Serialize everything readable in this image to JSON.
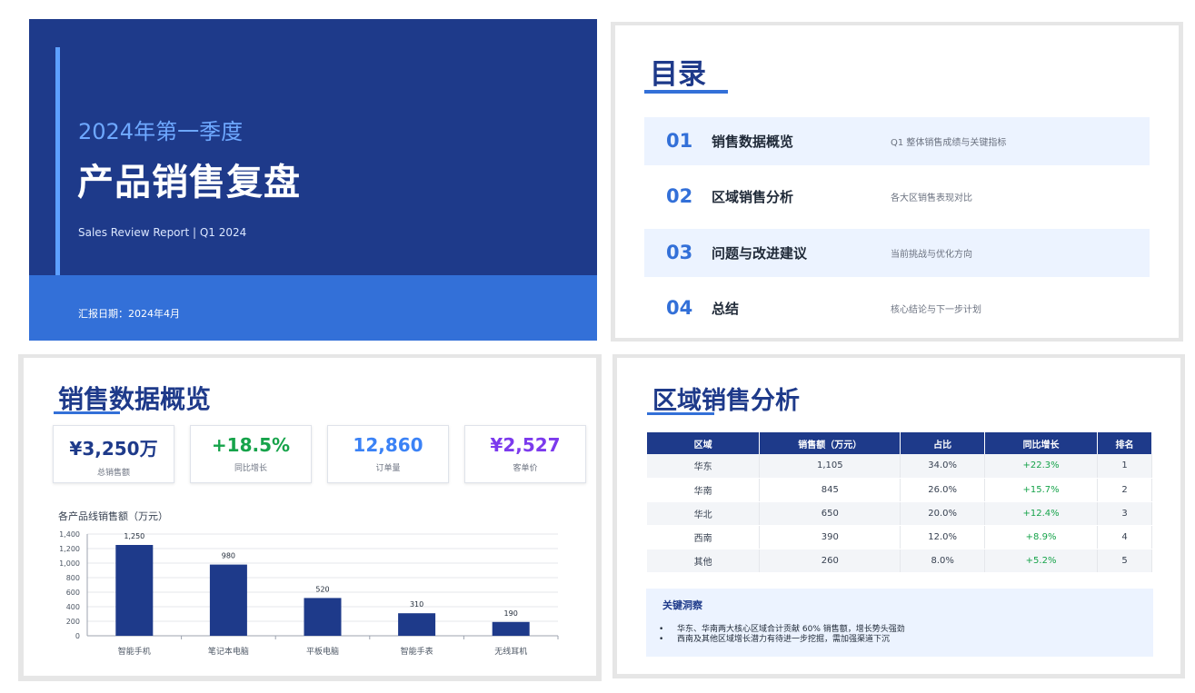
{
  "cover": {
    "subtitle": "2024年第一季度",
    "title": "产品销售复盘",
    "subtitle_en": "Sales Review Report | Q1 2024",
    "date_line": "汇报日期：2024年4月"
  },
  "agenda": {
    "title": "目录",
    "items": [
      {
        "num": "01",
        "name": "销售数据概览",
        "desc": "Q1 整体销售成绩与关键指标"
      },
      {
        "num": "02",
        "name": "区域销售分析",
        "desc": "各大区销售表现对比"
      },
      {
        "num": "03",
        "name": "问题与改进建议",
        "desc": "当前挑战与优化方向"
      },
      {
        "num": "04",
        "name": "总结",
        "desc": "核心结论与下一步计划"
      }
    ]
  },
  "overview": {
    "title": "销售数据概览",
    "kpis": [
      {
        "value": "¥3,250万",
        "label": "总销售额",
        "color": "#1e3a8a"
      },
      {
        "value": "+18.5%",
        "label": "同比增长",
        "color": "#16a34a"
      },
      {
        "value": "12,860",
        "label": "订单量",
        "color": "#3b82f6"
      },
      {
        "value": "¥2,527",
        "label": "客单价",
        "color": "#7c3aed"
      }
    ],
    "chart_title": "各产品线销售额（万元）"
  },
  "chart_data": {
    "type": "bar",
    "title": "各产品线销售额（万元）",
    "categories": [
      "智能手机",
      "笔记本电脑",
      "平板电脑",
      "智能手表",
      "无线耳机"
    ],
    "values": [
      1250,
      980,
      520,
      310,
      190
    ],
    "value_labels": [
      "1,250",
      "980",
      "520",
      "310",
      "190"
    ],
    "ylim": [
      0,
      1400
    ],
    "yticks": [
      0,
      200,
      400,
      600,
      800,
      1000,
      1200,
      1400
    ],
    "ytick_labels": [
      "0",
      "200",
      "400",
      "600",
      "800",
      "1,000",
      "1,200",
      "1,400"
    ],
    "grid": true,
    "bar_color": "#1e3a8a"
  },
  "region": {
    "title": "区域销售分析",
    "headers": [
      "区域",
      "销售额（万元）",
      "占比",
      "同比增长",
      "排名"
    ],
    "rows": [
      [
        "华东",
        "1,105",
        "34.0%",
        "+22.3%",
        "1"
      ],
      [
        "华南",
        "845",
        "26.0%",
        "+15.7%",
        "2"
      ],
      [
        "华北",
        "650",
        "20.0%",
        "+12.4%",
        "3"
      ],
      [
        "西南",
        "390",
        "12.0%",
        "+8.9%",
        "4"
      ],
      [
        "其他",
        "260",
        "8.0%",
        "+5.2%",
        "5"
      ]
    ],
    "insight_title": "关键洞察",
    "insights": [
      "华东、华南两大核心区域合计贡献 60% 销售额，增长势头强劲",
      "西南及其他区域增长潜力有待进一步挖掘，需加强渠道下沉"
    ]
  }
}
